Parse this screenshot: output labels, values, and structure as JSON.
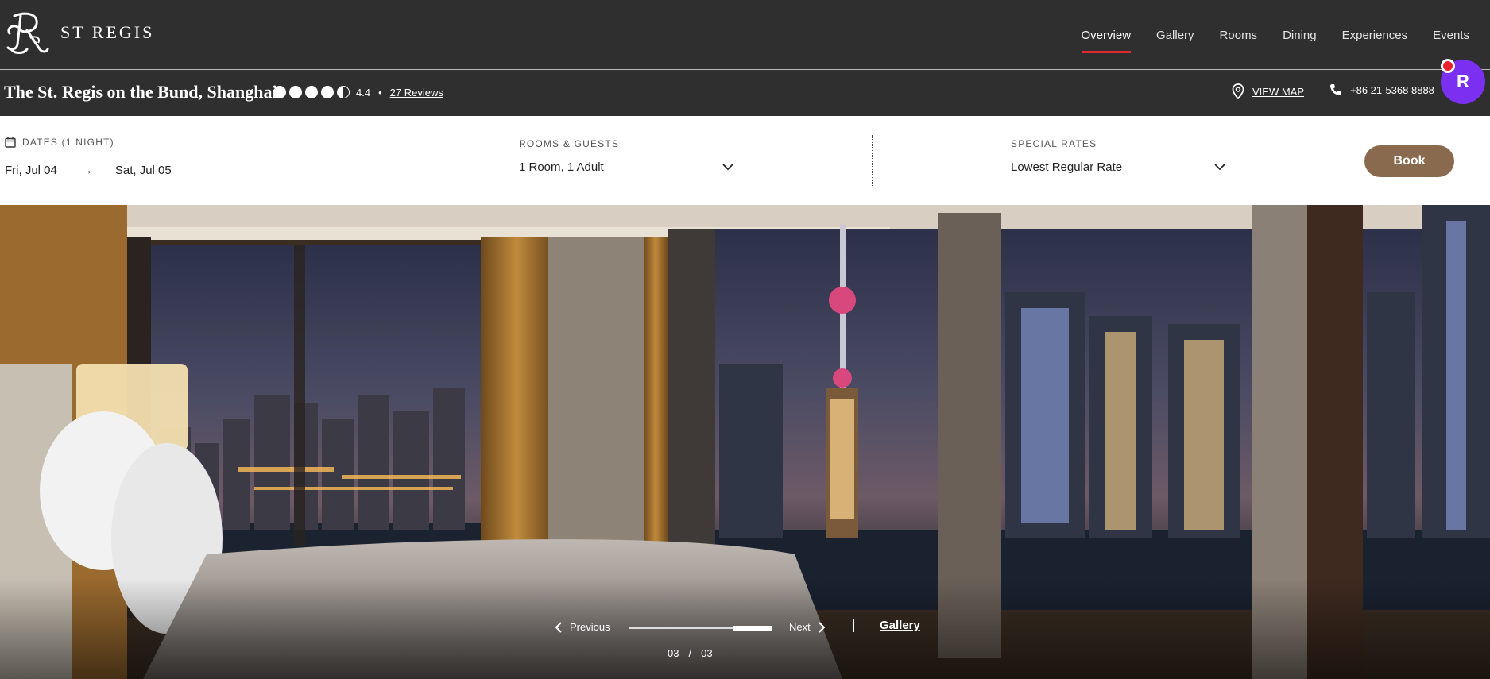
{
  "brand": {
    "logo_text": "ST REGIS",
    "logo_icon": "st-regis-monogram-icon"
  },
  "nav": {
    "items": [
      {
        "label": "Overview",
        "active": true
      },
      {
        "label": "Gallery",
        "active": false
      },
      {
        "label": "Rooms",
        "active": false
      },
      {
        "label": "Dining",
        "active": false
      },
      {
        "label": "Experiences",
        "active": false
      },
      {
        "label": "Events",
        "active": false
      }
    ],
    "active_underline_color": "#e0282f"
  },
  "hotel": {
    "name": "The St. Regis on the Bund, Shanghai",
    "rating_value": "4.4",
    "rating_score": 4.4,
    "rating_separator": "•",
    "reviews_label": "27 Reviews",
    "map_label": "VIEW MAP",
    "map_icon": "location-pin-icon",
    "phone_label": "+86 21-5368 8888",
    "phone_icon": "phone-icon"
  },
  "assistant": {
    "letter": "R",
    "color": "#7b2ff0",
    "badge_color": "#e8202a"
  },
  "booking": {
    "dates_label": "DATES (1 NIGHT)",
    "dates_icon": "calendar-icon",
    "check_in": "Fri, Jul 04",
    "arrow": "→",
    "check_out": "Sat, Jul 05",
    "rooms_label": "ROOMS & GUESTS",
    "rooms_value": "1 Room, 1 Adult",
    "rates_label": "SPECIAL RATES",
    "rates_value": "Lowest Regular Rate",
    "book_label": "Book",
    "book_color": "#8a6a4f"
  },
  "carousel": {
    "prev_label": "Previous",
    "next_label": "Next",
    "gallery_label": "Gallery",
    "current": "03",
    "separator": "/",
    "total": "03",
    "progress_fraction": 1.0
  }
}
